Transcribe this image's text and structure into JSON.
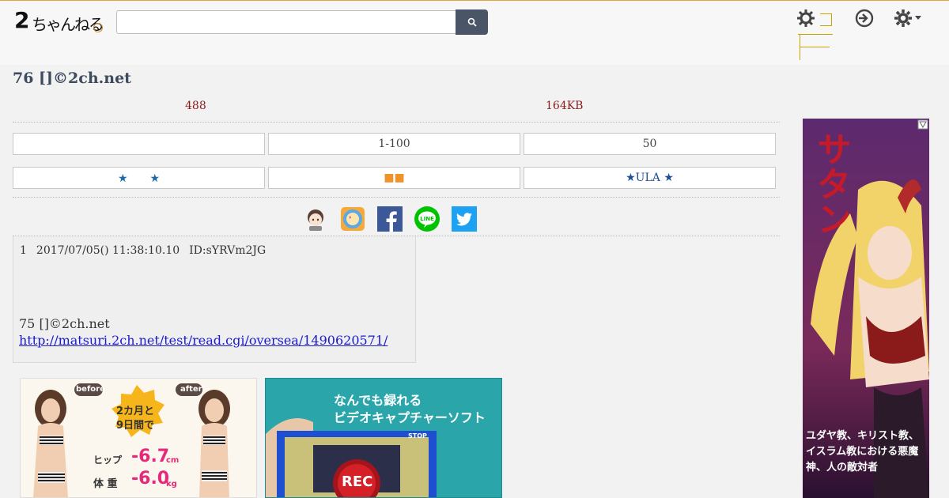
{
  "header": {
    "logo_num": "2",
    "logo_kana": "ちゃんねる",
    "search_placeholder": "",
    "menu_label": ""
  },
  "thread": {
    "title": "76 []©2ch.net",
    "reply_count": "488",
    "size": "164KB"
  },
  "buttons_row1": [
    "",
    "1-100",
    "50"
  ],
  "buttons_row2": [
    "★　　★",
    "■■",
    "★ULA ★"
  ],
  "share": [
    "avatar-share",
    "news-share",
    "facebook",
    "line",
    "twitter"
  ],
  "post": {
    "number": "1",
    "date": "2017/07/05() 11:38:10.10",
    "id": "ID:sYRVm2JG",
    "body_line": "75 []©2ch.net",
    "link": "http://matsuri.2ch.net/test/read.cgi/oversea/1490620571/"
  },
  "ads": {
    "ad1_before": "before",
    "ad1_after": "after",
    "ad1_badge_1": "2カ月と",
    "ad1_badge_2": "9日間で",
    "ad1_hip_label": "ヒップ",
    "ad1_hip_value": "-6.7",
    "ad1_hip_unit": "cm",
    "ad1_weight_label": "体 重",
    "ad1_weight_value": "-6.0",
    "ad1_weight_unit": "kg",
    "ad2_line1": "なんでも録れる",
    "ad2_line2": "ビデオキャプチャーソフト",
    "ad2_stop": "STOP",
    "ad2_rec": "REC",
    "ad3_title": "サタン",
    "ad3_text1": "ユダヤ教、キリスト教、",
    "ad3_text2": "イスラム教における悪魔",
    "ad3_text3": "神、人の敵対者"
  },
  "colors": {
    "accent_orange": "#e8a33d",
    "search_button": "#4a5568",
    "title": "#3e4a5e",
    "meta_red": "#8b1c1c",
    "link_blue": "#1a1ad0"
  }
}
